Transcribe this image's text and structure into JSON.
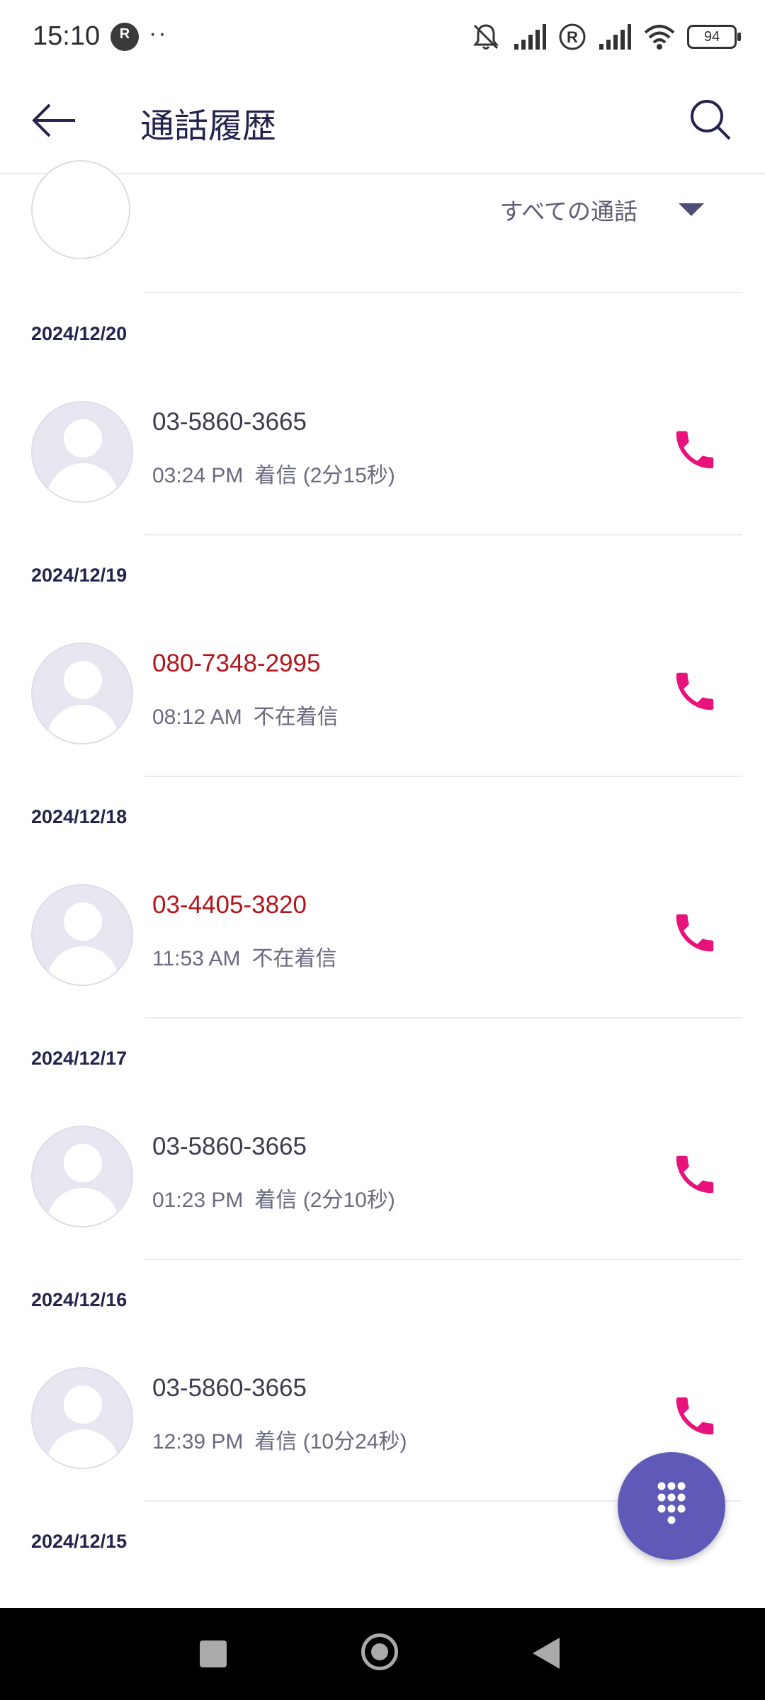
{
  "status_bar": {
    "time": "15:10",
    "rlink_badge": "R",
    "dots": "··",
    "battery": "94",
    "icons": [
      "mute-bell-icon",
      "signal-icon",
      "roaming-r-icon",
      "signal-icon",
      "wifi-icon",
      "battery-icon"
    ]
  },
  "app_bar": {
    "title": "通話履歴",
    "back_icon": "arrow-left-icon",
    "search_icon": "search-icon"
  },
  "filter": {
    "selected": "すべての通話"
  },
  "colors": {
    "accent": "#5f5ab7",
    "call_icon": "#e8127c",
    "missed_text": "#b3151c",
    "title_text": "#23234d"
  },
  "calls": [
    {
      "date": "2024/12/20",
      "number": "03-5860-3665",
      "time": "03:24 PM",
      "status": "着信 (2分15秒)",
      "missed": false
    },
    {
      "date": "2024/12/19",
      "number": "080-7348-2995",
      "time": "08:12 AM",
      "status": "不在着信",
      "missed": true
    },
    {
      "date": "2024/12/18",
      "number": "03-4405-3820",
      "time": "11:53 AM",
      "status": "不在着信",
      "missed": true
    },
    {
      "date": "2024/12/17",
      "number": "03-5860-3665",
      "time": "01:23 PM",
      "status": "着信 (2分10秒)",
      "missed": false
    },
    {
      "date": "2024/12/16",
      "number": "03-5860-3665",
      "time": "12:39 PM",
      "status": "着信 (10分24秒)",
      "missed": false
    }
  ],
  "next_date": "2024/12/15"
}
